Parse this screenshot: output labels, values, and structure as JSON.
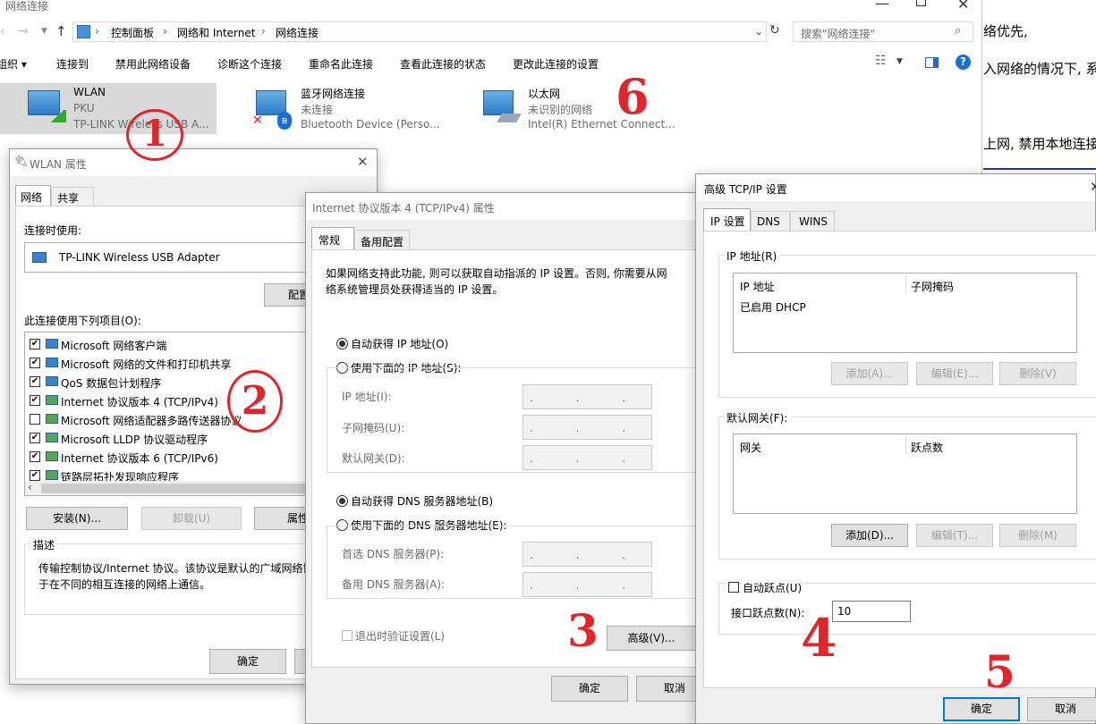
{
  "explorer": {
    "title": "网络连接",
    "breadcrumb": [
      "控制面板",
      "网络和 Internet",
      "网络连接"
    ],
    "search_placeholder": "搜索\"网络连接\"",
    "toolbar": [
      "组织 ▾",
      "连接到",
      "禁用此网络设备",
      "诊断这个连接",
      "重命名此连接",
      "查看此连接的状态",
      "更改此连接的设置"
    ],
    "connections": [
      {
        "name": "WLAN",
        "line2": "PKU",
        "line3": "TP-LINK Wireless USB A..."
      },
      {
        "name": "蓝牙网络连接",
        "line2": "未连接",
        "line3": "Bluetooth Device (Perso..."
      },
      {
        "name": "以太网",
        "line2": "未识别的网络",
        "line3": "Intel(R) Ethernet Connect..."
      }
    ]
  },
  "bg_text": [
    "络优先,",
    "入网络的情况下, 系",
    "上网, 禁用本地连接"
  ],
  "wlan": {
    "title": "WLAN 属性",
    "tabs": [
      "网络",
      "共享"
    ],
    "connect_using": "连接时使用:",
    "adapter": "TP-LINK Wireless USB Adapter",
    "configure": "配置",
    "items_label": "此连接使用下列项目(O):",
    "items": [
      {
        "label": "Microsoft 网络客户端",
        "checked": "✔"
      },
      {
        "label": "Microsoft 网络的文件和打印机共享",
        "checked": "✔"
      },
      {
        "label": "QoS 数据包计划程序",
        "checked": "✔"
      },
      {
        "label": "Internet 协议版本 4 (TCP/IPv4)",
        "checked": "✔"
      },
      {
        "label": "Microsoft 网络适配器多路传送器协议",
        "checked": ""
      },
      {
        "label": "Microsoft LLDP 协议驱动程序",
        "checked": "✔"
      },
      {
        "label": "Internet 协议版本 6 (TCP/IPv6)",
        "checked": "✔"
      },
      {
        "label": "链路层拓扑发现响应程序",
        "checked": "✔"
      }
    ],
    "install": "安装(N)...",
    "uninstall": "卸载(U)",
    "properties": "属性",
    "desc_label": "描述",
    "desc_line1": "传输控制协议/Internet 协议。该协议是默认的广域网络协",
    "desc_line2": "于在不同的相互连接的网络上通信。",
    "ok": "确定"
  },
  "ipv4": {
    "title": "Internet 协议版本 4 (TCP/IPv4) 属性",
    "tabs": [
      "常规",
      "备用配置"
    ],
    "intro1": "如果网络支持此功能, 则可以获取自动指派的 IP 设置。否则, 你需要从网",
    "intro2": "络系统管理员处获得适当的 IP 设置。",
    "auto_ip": "自动获得 IP 地址(O)",
    "manual_ip": "使用下面的 IP 地址(S):",
    "ip_label": "IP 地址(I):",
    "mask_label": "子网掩码(U):",
    "gw_label": "默认网关(D):",
    "auto_dns": "自动获得 DNS 服务器地址(B)",
    "manual_dns": "使用下面的 DNS 服务器地址(E):",
    "dns1_label": "首选 DNS 服务器(P):",
    "dns2_label": "备用 DNS 服务器(A):",
    "blank_ip": ". . .",
    "validate": "退出时验证设置(L)",
    "advanced": "高级(V)...",
    "ok": "确定",
    "cancel": "取消"
  },
  "adv": {
    "title": "高级 TCP/IP 设置",
    "tabs": [
      "IP 设置",
      "DNS",
      "WINS"
    ],
    "ip_group": "IP 地址(R)",
    "col_ip": "IP 地址",
    "col_mask": "子网掩码",
    "dhcp": "已启用 DHCP",
    "add": "添加(A)...",
    "edit": "编辑(E)...",
    "remove": "删除(V)",
    "gw_group": "默认网关(F):",
    "col_gw": "网关",
    "col_metric": "跃点数",
    "add2": "添加(D)...",
    "edit2": "编辑(T)...",
    "remove2": "删除(M)",
    "auto_metric": "自动跃点(U)",
    "iface_metric": "接口跃点数(N):",
    "metric_value": "10",
    "ok": "确定",
    "cancel": "取消"
  },
  "annotations": [
    "1",
    "2",
    "3",
    "4",
    "5",
    "6"
  ]
}
